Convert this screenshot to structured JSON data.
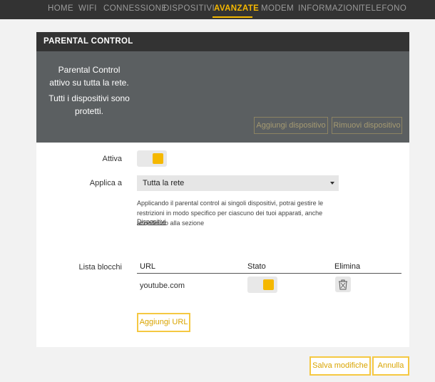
{
  "nav": {
    "tabs": [
      {
        "label": "HOME"
      },
      {
        "label": "WIFI"
      },
      {
        "label": "CONNESSIONE"
      },
      {
        "label": "DISPOSITIVI"
      },
      {
        "label": "AVANZATE"
      },
      {
        "label": "MODEM"
      },
      {
        "label": "INFORMAZIONI"
      },
      {
        "label": "TELEFONO"
      }
    ],
    "active_index": 4
  },
  "card": {
    "title": "PARENTAL CONTROL",
    "status_line1": "Parental Control",
    "status_line2": "attivo su tutta la rete.",
    "status_line3": "Tutti i dispositivi sono",
    "status_line4": "protetti.",
    "add_device_label": "Aggiungi dispositivo",
    "remove_device_label": "Rimuovi dispositivo"
  },
  "form": {
    "active_label": "Attiva",
    "active_on": true,
    "apply_label": "Applica a",
    "apply_value": "Tutta la rete",
    "help_text": "Applicando il parental control ai singoli dispositivi, potrai gestire le restrizioni in modo specifico per ciascuno dei tuoi apparati, anche accedendo alla sezione",
    "help_link": "Dispositivi",
    "blocklist_label": "Lista blocchi"
  },
  "blocklist": {
    "headers": {
      "url": "URL",
      "state": "Stato",
      "delete": "Elimina"
    },
    "rows": [
      {
        "url": "youtube.com",
        "enabled": true
      }
    ],
    "add_url_label": "Aggiungi URL"
  },
  "footer": {
    "save_label": "Salva modifiche",
    "cancel_label": "Annulla"
  },
  "colors": {
    "accent": "#f5b800",
    "dark_bar": "#333333",
    "panel": "#5b5f61"
  }
}
